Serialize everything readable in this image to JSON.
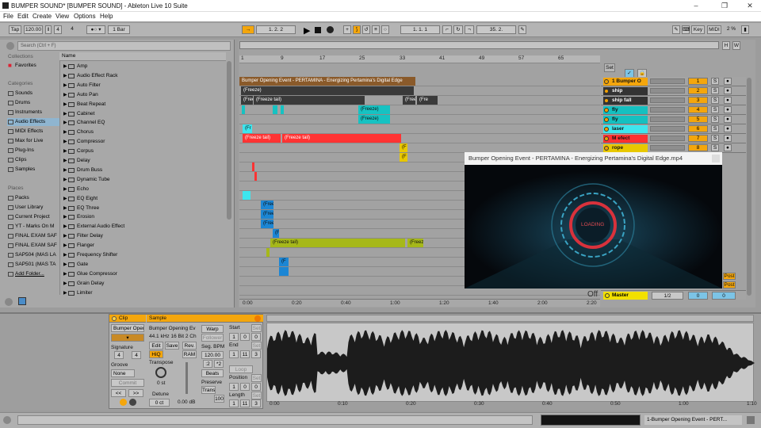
{
  "window": {
    "title": "BUMPER SOUND*  [BUMPER SOUND] - Ableton Live 10 Suite"
  },
  "menu": [
    "File",
    "Edit",
    "Create",
    "View",
    "Options",
    "Help"
  ],
  "transport": {
    "tap": "Tap",
    "tempo": "120.00",
    "sig_num": "4",
    "sig_den": "4",
    "quantize": "1 Bar",
    "position": "1.  2.  2",
    "loop_start": "1.  1.  1",
    "loop_len": "35.  2.",
    "key": "Key",
    "midi": "MIDI",
    "cpu": "2 %"
  },
  "browser": {
    "search_placeholder": "Search (Ctrl + F)",
    "collections_label": "Collections",
    "favorites": "Favorites",
    "categories_label": "Categories",
    "categories": [
      "Sounds",
      "Drums",
      "Instruments",
      "Audio Effects",
      "MIDI Effects",
      "Max for Live",
      "Plug-Ins",
      "Clips",
      "Samples"
    ],
    "places_label": "Places",
    "places": [
      "Packs",
      "User Library",
      "Current Project",
      "YT - Marks On M",
      "FINAL EXAM SAF",
      "FINAL EXAM SAF",
      "SAP504 (MAS LA",
      "SAP501 (MAS TA",
      "Add Folder..."
    ],
    "name_header": "Name",
    "items": [
      "Amp",
      "Audio Effect Rack",
      "Auto Filter",
      "Auto Pan",
      "Beat Repeat",
      "Cabinet",
      "Channel EQ",
      "Chorus",
      "Compressor",
      "Corpus",
      "Delay",
      "Drum Buss",
      "Dynamic Tube",
      "Echo",
      "EQ Eight",
      "EQ Three",
      "Erosion",
      "External Audio Effect",
      "Filter Delay",
      "Flanger",
      "Frequency Shifter",
      "Gate",
      "Glue Compressor",
      "Grain Delay",
      "Limiter"
    ]
  },
  "ruler": [
    "1",
    "9",
    "17",
    "25",
    "33",
    "41",
    "49",
    "57",
    "65"
  ],
  "set_label": "Set",
  "timecodes": [
    "0:00",
    "0:20",
    "0:40",
    "1:00",
    "1:20",
    "1:40",
    "2:00",
    "2:20"
  ],
  "tracks": [
    {
      "name": "1 Bumper O",
      "num": "1",
      "color": "#f4a60c"
    },
    {
      "name": "ship",
      "num": "2",
      "color": "#333333"
    },
    {
      "name": "ship fall",
      "num": "3",
      "color": "#333333"
    },
    {
      "name": "fly",
      "num": "4",
      "color": "#15c0c0"
    },
    {
      "name": "fly",
      "num": "5",
      "color": "#15c0c0"
    },
    {
      "name": "laser",
      "num": "6",
      "color": "#3ee6ee"
    },
    {
      "name": "M efect",
      "num": "7",
      "color": "#ff3030"
    },
    {
      "name": "rope",
      "num": "8",
      "color": "#e8c800"
    }
  ],
  "clips": {
    "c1": "Bumper Opening Event - PERTAMINA - Energizing Pertamina's Digital Edge",
    "c2": "(Freeze)",
    "c3": "(Free",
    "c4": "(Freeze tail)",
    "c5": "(Freez",
    "c6": "(Freeze)",
    "c7": "(Freeze)",
    "c8": "(Fr",
    "c9": "(Freeze tail)",
    "c10": "(Freeze tail)",
    "c11": "(F",
    "c12": "(F",
    "c13": "(Free",
    "c14": "(Free",
    "c15": "(Free",
    "c16": "(F",
    "c17": "(Freeze tail)",
    "c18": "(Freez",
    "c19": "(F",
    "c20": "(Fre"
  },
  "master": {
    "name": "Master",
    "routing": "1/2",
    "v1": "0",
    "v2": "0",
    "off": "Off",
    "post": "Post"
  },
  "video": {
    "title": "Bumper Opening Event - PERTAMINA - Energizing Pertamina's Digital Edge.mp4",
    "loading": "LOADING"
  },
  "clippanel": {
    "clip_label": "Clip",
    "sample_label": "Sample",
    "clip_name": "Bumper Open",
    "sample_name": "Bumper Opening Ev",
    "sample_info": "44.1 kHz 16 Bit 2 Ch",
    "edit": "Edit",
    "save": "Save",
    "rev": "Rev.",
    "hiq": "HiQ",
    "ram": "RAM",
    "warp": "Warp",
    "follower": "Follower",
    "seg_bpm_label": "Seg. BPM",
    "seg_bpm": "120.00",
    "half": ":2",
    "double": "*2",
    "beats": "Beats",
    "preserve": "Preserve",
    "trans": "Trans",
    "pct": "100",
    "start": "Start",
    "end": "End",
    "loop": "Loop",
    "position": "Position",
    "length": "Length",
    "set": "Set",
    "start_v": [
      "1",
      "0",
      "0"
    ],
    "end_v": [
      "1",
      "11",
      "3"
    ],
    "pos_v": [
      "1",
      "0",
      "0"
    ],
    "len_v": [
      "1",
      "11",
      "3"
    ],
    "signature": "Signature",
    "sig_num": "4",
    "sig_den": "4",
    "groove": "Groove",
    "groove_v": "None",
    "commit": "Commit",
    "transpose": "Transpose",
    "transpose_v": "0 st",
    "detune": "Detune",
    "detune_v": "0 ct",
    "gain": "0.00 dB",
    "nav_prev": "<<",
    "nav_next": ">>"
  },
  "wave_times": [
    "0:00",
    "0:10",
    "0:20",
    "0:30",
    "0:40",
    "0:50",
    "1:00",
    "1:10"
  ],
  "status": {
    "track": "1-Bumper Opening Event - PERT..."
  }
}
